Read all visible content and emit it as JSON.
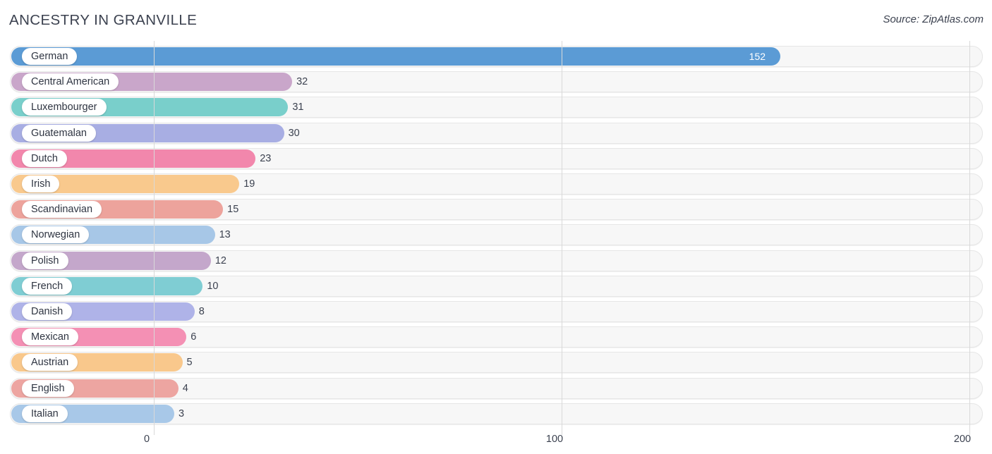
{
  "header": {
    "title": "ANCESTRY IN GRANVILLE",
    "source": "Source: ZipAtlas.com"
  },
  "axis": {
    "ticks": [
      "0",
      "100",
      "200"
    ]
  },
  "chart_data": {
    "type": "bar",
    "orientation": "horizontal",
    "title": "ANCESTRY IN GRANVILLE",
    "xlabel": "",
    "ylabel": "",
    "xlim": [
      0,
      200
    ],
    "grid": true,
    "legend": "none",
    "source": "Source: ZipAtlas.com",
    "categories": [
      "German",
      "Central American",
      "Luxembourger",
      "Guatemalan",
      "Dutch",
      "Irish",
      "Scandinavian",
      "Norwegian",
      "Polish",
      "French",
      "Danish",
      "Mexican",
      "Austrian",
      "English",
      "Italian"
    ],
    "values": [
      152,
      32,
      31,
      30,
      23,
      19,
      15,
      13,
      12,
      10,
      8,
      6,
      5,
      4,
      3
    ],
    "colors": [
      "#5b9bd5",
      "#c9a6ca",
      "#79cfcb",
      "#a8aee3",
      "#f287ac",
      "#f9c98d",
      "#eda39c",
      "#a7c7e7",
      "#c4a7cb",
      "#7fcdd3",
      "#afb3e8",
      "#f490b4",
      "#f9c88c",
      "#eda5a1",
      "#a8c8e8"
    ],
    "bars": [
      {
        "label": "German",
        "value": 152,
        "value_text": "152",
        "color": "#5b9bd5",
        "value_inside": true
      },
      {
        "label": "Central American",
        "value": 32,
        "value_text": "32",
        "color": "#c9a6ca",
        "value_inside": false
      },
      {
        "label": "Luxembourger",
        "value": 31,
        "value_text": "31",
        "color": "#79cfcb",
        "value_inside": false
      },
      {
        "label": "Guatemalan",
        "value": 30,
        "value_text": "30",
        "color": "#a8aee3",
        "value_inside": false
      },
      {
        "label": "Dutch",
        "value": 23,
        "value_text": "23",
        "color": "#f287ac",
        "value_inside": false
      },
      {
        "label": "Irish",
        "value": 19,
        "value_text": "19",
        "color": "#f9c98d",
        "value_inside": false
      },
      {
        "label": "Scandinavian",
        "value": 15,
        "value_text": "15",
        "color": "#eda39c",
        "value_inside": false
      },
      {
        "label": "Norwegian",
        "value": 13,
        "value_text": "13",
        "color": "#a7c7e7",
        "value_inside": false
      },
      {
        "label": "Polish",
        "value": 12,
        "value_text": "12",
        "color": "#c4a7cb",
        "value_inside": false
      },
      {
        "label": "French",
        "value": 10,
        "value_text": "10",
        "color": "#7fcdd3",
        "value_inside": false
      },
      {
        "label": "Danish",
        "value": 8,
        "value_text": "8",
        "color": "#afb3e8",
        "value_inside": false
      },
      {
        "label": "Mexican",
        "value": 6,
        "value_text": "6",
        "color": "#f490b4",
        "value_inside": false
      },
      {
        "label": "Austrian",
        "value": 5,
        "value_text": "5",
        "color": "#f9c88c",
        "value_inside": false
      },
      {
        "label": "English",
        "value": 4,
        "value_text": "4",
        "color": "#eda5a1",
        "value_inside": false
      },
      {
        "label": "Italian",
        "value": 3,
        "value_text": "3",
        "color": "#a8c8e8",
        "value_inside": false
      }
    ]
  }
}
